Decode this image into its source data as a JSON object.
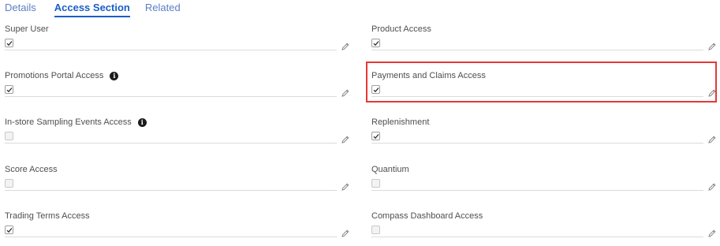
{
  "tabs": [
    {
      "label": "Details",
      "active": false
    },
    {
      "label": "Access Section",
      "active": true
    },
    {
      "label": "Related",
      "active": false
    }
  ],
  "fields": [
    {
      "label": "Super User",
      "checked": true,
      "info": false
    },
    {
      "label": "Product Access",
      "checked": true,
      "info": false
    },
    {
      "label": "Promotions Portal Access",
      "checked": true,
      "info": true
    },
    {
      "label": "Payments and Claims Access",
      "checked": true,
      "info": false,
      "highlighted": true
    },
    {
      "label": "In-store Sampling Events Access",
      "checked": false,
      "info": true
    },
    {
      "label": "Replenishment",
      "checked": true,
      "info": false
    },
    {
      "label": "Score Access",
      "checked": false,
      "info": false
    },
    {
      "label": "Quantium",
      "checked": false,
      "info": false
    },
    {
      "label": "Trading Terms Access",
      "checked": true,
      "info": false
    },
    {
      "label": "Compass Dashboard Access",
      "checked": false,
      "info": false
    }
  ],
  "icons": {
    "info": "info-icon",
    "edit": "pencil-icon",
    "check": "checkmark-icon"
  },
  "colors": {
    "accent": "#1b5dc7",
    "highlight_border": "#e53935"
  }
}
